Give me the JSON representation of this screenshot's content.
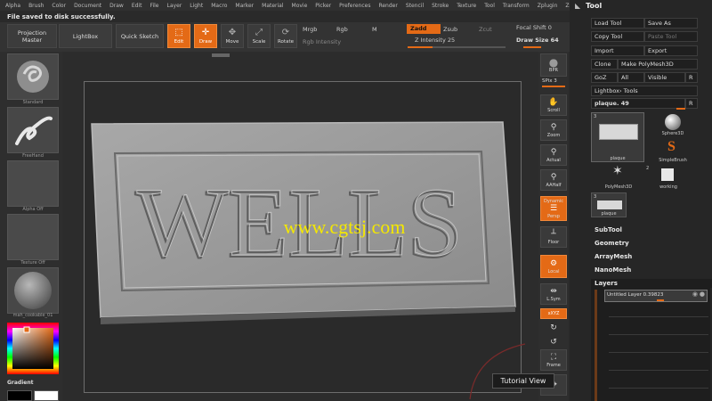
{
  "menu": [
    "Alpha",
    "Brush",
    "Color",
    "Document",
    "Draw",
    "Edit",
    "File",
    "Layer",
    "Light",
    "Macro",
    "Marker",
    "Material",
    "Movie",
    "Picker",
    "Preferences",
    "Render",
    "Stencil",
    "Stroke",
    "Texture",
    "Tool",
    "Transform",
    "Zplugin",
    "Zscript"
  ],
  "status_message": "File saved to disk successfully.",
  "top_shelf": {
    "projection_master": "Projection Master",
    "lightbox": "LightBox",
    "quick_sketch": "Quick Sketch",
    "edit": "Edit",
    "draw": "Draw",
    "move": "Move",
    "scale": "Scale",
    "rotate": "Rotate",
    "mrgb": "Mrgb",
    "rgb": "Rgb",
    "m": "M",
    "rgb_intensity": "Rgb Intensity",
    "zadd": "Zadd",
    "zsub": "Zsub",
    "zcut": "Zcut",
    "z_intensity": "Z Intensity 25",
    "z_intensity_value": 0.25,
    "focal_shift": "Focal Shift 0",
    "draw_size": "Draw Size 64"
  },
  "left_shelf": {
    "brush_label": "Standard",
    "stroke_label": "FreeHand",
    "alpha_label": "Alpha Off",
    "texture_label": "Texture Off",
    "material_label": "mah_cookable_01",
    "gradient_label": "Gradient"
  },
  "canvas": {
    "plaque_text": "WELLS",
    "watermark": "www.cgtsj.com"
  },
  "right_shelf": {
    "bpr": "BPR",
    "spix": "SPix 3",
    "scroll": "Scroll",
    "zoom": "Zoom",
    "actual": "Actual",
    "aahalf": "AAHalf",
    "dynamic": "Dynamic",
    "persp": "Persp",
    "floor": "Floor",
    "local": "Local",
    "lsym": "L.Sym",
    "xyz": "xXYZ",
    "frame": "Frame"
  },
  "tool_panel": {
    "title": "Tool",
    "load_tool": "Load Tool",
    "save_as": "Save As",
    "copy_tool": "Copy Tool",
    "paste_tool": "Paste Tool",
    "import": "Import",
    "export": "Export",
    "clone": "Clone",
    "make_polymesh": "Make PolyMesh3D",
    "goz": "GoZ",
    "all": "All",
    "visible": "Visible",
    "r": "R",
    "lightbox_tools": "Lightbox› Tools",
    "current_tool": "plaque. 49",
    "items": [
      {
        "label": "plaque",
        "badge": "3"
      },
      {
        "label": "Sphere3D",
        "badge": ""
      },
      {
        "label": "SimpleBrush",
        "badge": ""
      },
      {
        "label": "PolyMesh3D",
        "badge": ""
      },
      {
        "label": "working",
        "badge": "2"
      },
      {
        "label": "plaque",
        "badge": "3"
      }
    ],
    "sections": [
      "SubTool",
      "Geometry",
      "ArrayMesh",
      "NanoMesh",
      "Layers"
    ],
    "layer_name": "Untitled Layer 0.39823"
  },
  "tutorial_view": "Tutorial View",
  "colors": {
    "accent": "#e46a16",
    "panel": "#262626",
    "canvas_bg": "#2c2c2c",
    "plaque": "#9a9a9a"
  }
}
